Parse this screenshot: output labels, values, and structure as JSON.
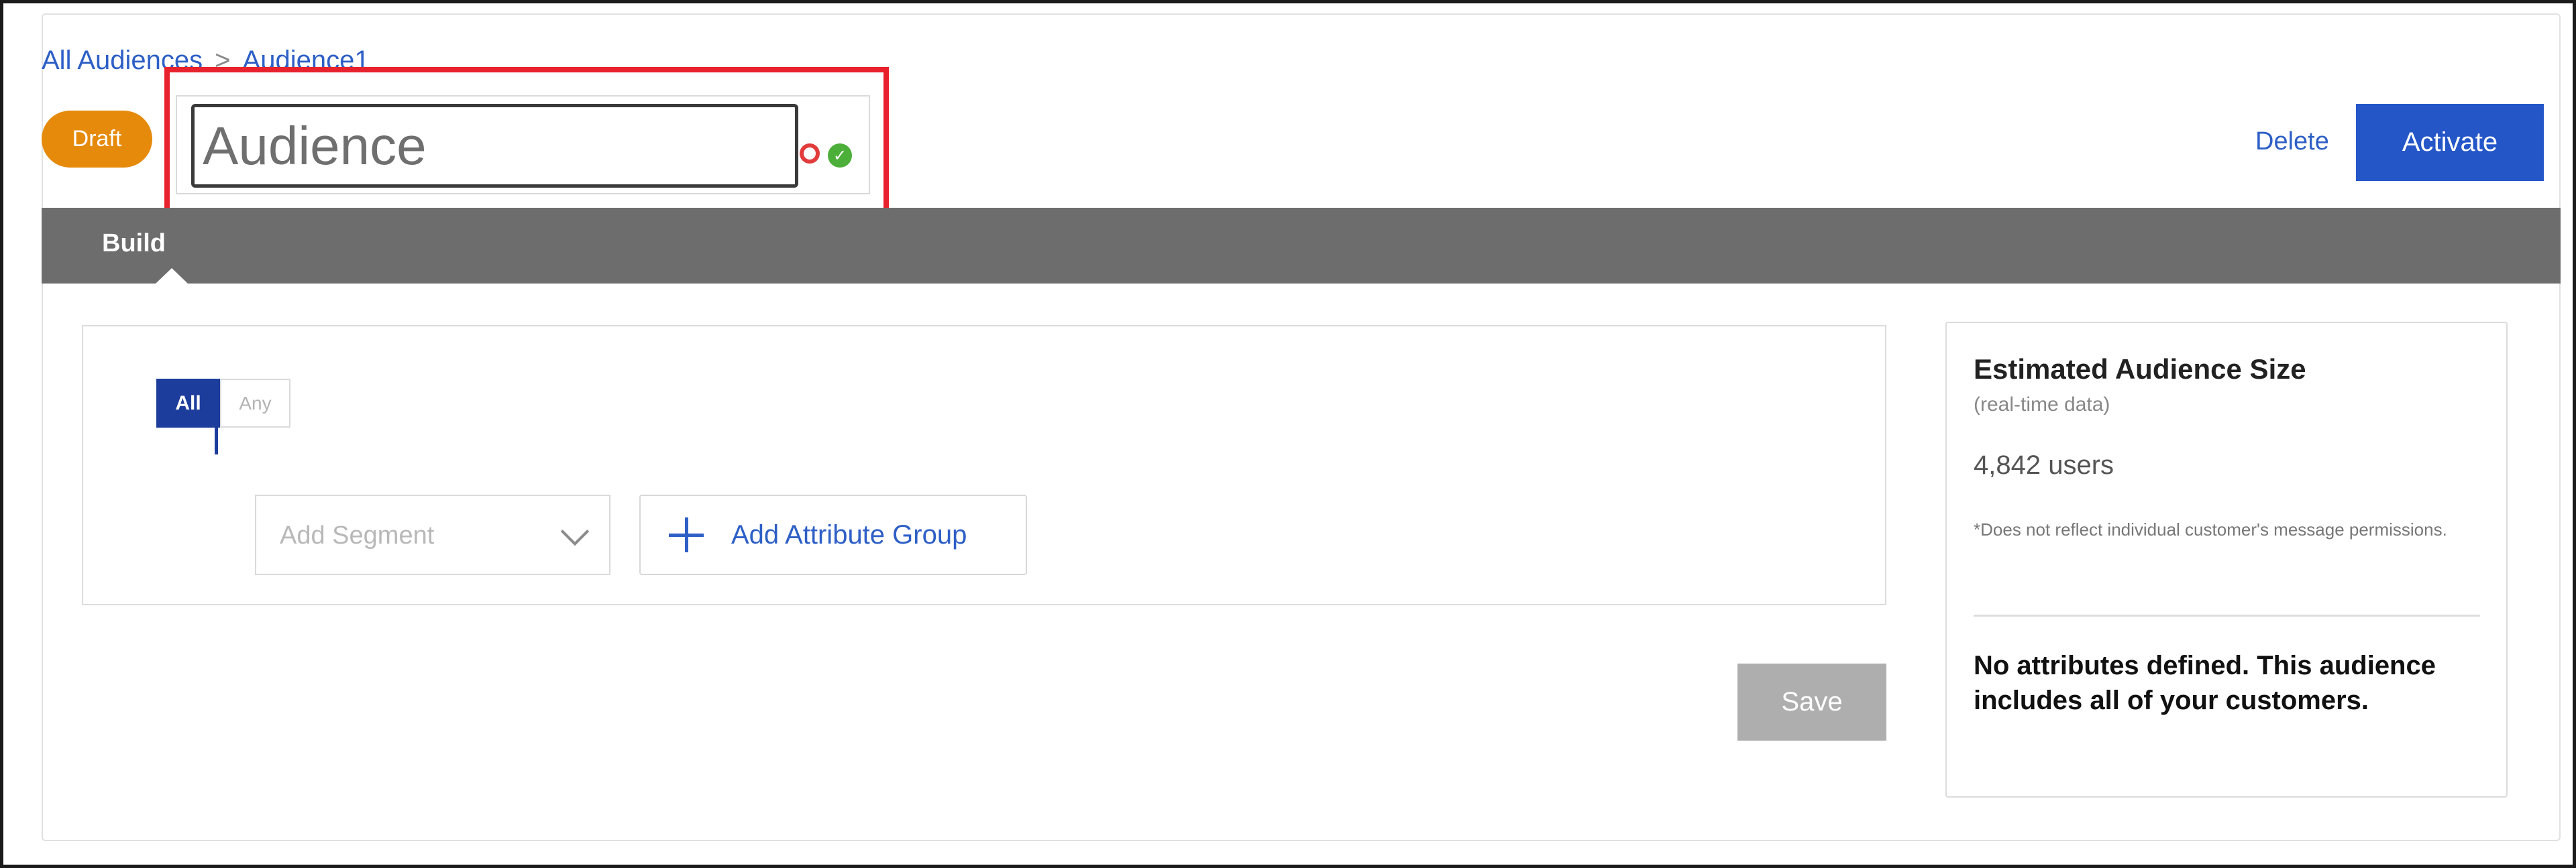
{
  "breadcrumb": {
    "parent": "All Audiences",
    "separator": ">",
    "current": "Audience1"
  },
  "status": {
    "label": "Draft",
    "color": "#e68a0c"
  },
  "name_editor": {
    "value": "Audience",
    "cancel_icon": "cancel-circle-icon",
    "confirm_icon": "check-circle-icon"
  },
  "header_actions": {
    "delete_label": "Delete",
    "activate_label": "Activate",
    "accent": "#2456c8"
  },
  "tabs": [
    {
      "label": "Build",
      "active": true
    }
  ],
  "builder": {
    "match_all_label": "All",
    "match_any_label": "Any",
    "segment_placeholder": "Add Segment",
    "add_attribute_group_label": "Add Attribute Group",
    "save_label": "Save"
  },
  "summary": {
    "title": "Estimated Audience Size",
    "subtitle": "(real-time data)",
    "count": "4,842 users",
    "note": "*Does not reflect individual customer's message permissions.",
    "empty_message": "No attributes defined. This audience includes all of your customers."
  },
  "highlight_color": "#e8222d"
}
